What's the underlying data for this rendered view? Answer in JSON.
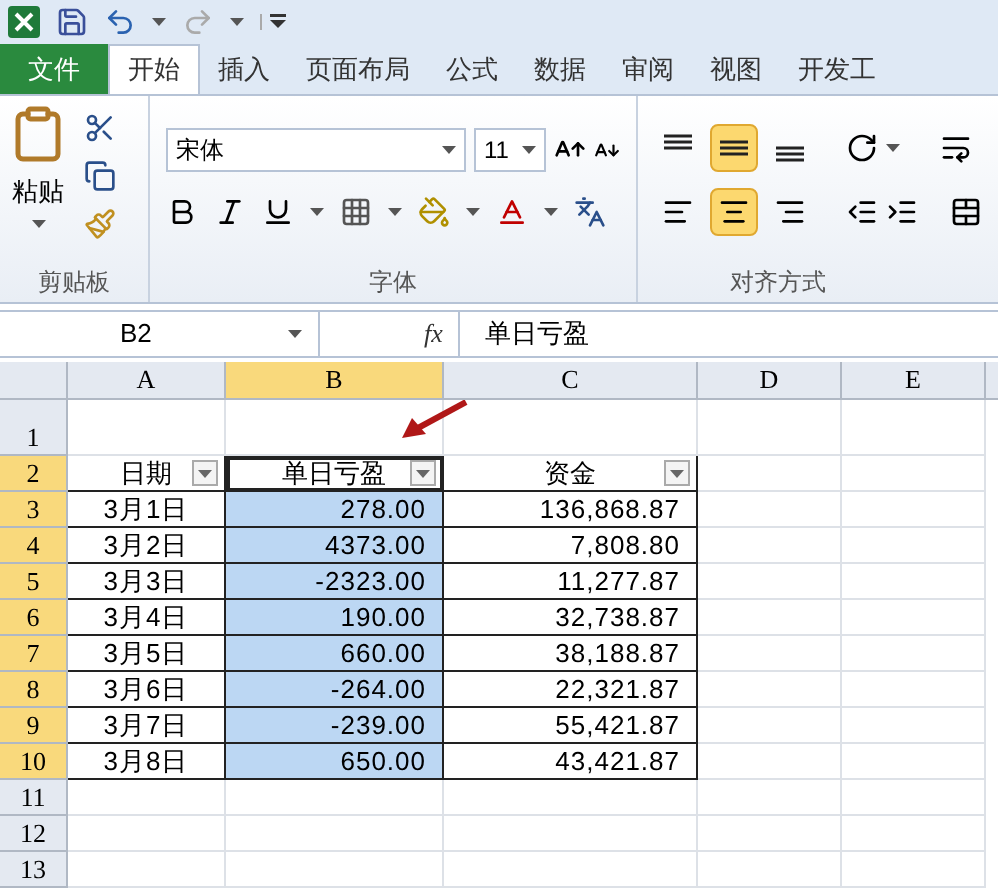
{
  "ribbon_tabs": [
    {
      "label": "文件",
      "kind": "file",
      "selected": false
    },
    {
      "label": "开始",
      "kind": "tab",
      "selected": true
    },
    {
      "label": "插入",
      "kind": "tab",
      "selected": false
    },
    {
      "label": "页面布局",
      "kind": "tab",
      "selected": false
    },
    {
      "label": "公式",
      "kind": "tab",
      "selected": false
    },
    {
      "label": "数据",
      "kind": "tab",
      "selected": false
    },
    {
      "label": "审阅",
      "kind": "tab",
      "selected": false
    },
    {
      "label": "视图",
      "kind": "tab",
      "selected": false
    },
    {
      "label": "开发工",
      "kind": "tab",
      "selected": false
    }
  ],
  "clipboard": {
    "paste_label": "粘贴",
    "group_label": "剪贴板"
  },
  "font": {
    "font_name": "宋体",
    "font_size": "11",
    "group_label": "字体"
  },
  "alignment": {
    "group_label": "对齐方式",
    "vertical": [
      {
        "kind": "top",
        "selected": false
      },
      {
        "kind": "middle",
        "selected": true
      },
      {
        "kind": "bottom",
        "selected": false
      }
    ],
    "horizontal": [
      {
        "kind": "left",
        "selected": false
      },
      {
        "kind": "center",
        "selected": true
      },
      {
        "kind": "right",
        "selected": false
      }
    ]
  },
  "formula_bar": {
    "name_box": "B2",
    "fx": "fx",
    "content": "单日亏盈"
  },
  "sheet": {
    "columns": [
      {
        "label": "A",
        "selected": false
      },
      {
        "label": "B",
        "selected": true
      },
      {
        "label": "C",
        "selected": false
      },
      {
        "label": "D",
        "selected": false
      },
      {
        "label": "E",
        "selected": false
      }
    ],
    "rows": [
      {
        "number": "1",
        "selected": false
      },
      {
        "number": "2",
        "selected": true,
        "header": [
          "日期",
          "单日亏盈",
          "资金"
        ]
      },
      {
        "number": "3",
        "selected": true,
        "cells": [
          "3月1日",
          "278.00",
          "136,868.87"
        ]
      },
      {
        "number": "4",
        "selected": true,
        "cells": [
          "3月2日",
          "4373.00",
          "7,808.80"
        ]
      },
      {
        "number": "5",
        "selected": true,
        "cells": [
          "3月3日",
          "-2323.00",
          "11,277.87"
        ]
      },
      {
        "number": "6",
        "selected": true,
        "cells": [
          "3月4日",
          "190.00",
          "32,738.87"
        ]
      },
      {
        "number": "7",
        "selected": true,
        "cells": [
          "3月5日",
          "660.00",
          "38,188.87"
        ]
      },
      {
        "number": "8",
        "selected": true,
        "cells": [
          "3月6日",
          "-264.00",
          "22,321.87"
        ]
      },
      {
        "number": "9",
        "selected": true,
        "cells": [
          "3月7日",
          "-239.00",
          "55,421.87"
        ]
      },
      {
        "number": "10",
        "selected": true,
        "cells": [
          "3月8日",
          "650.00",
          "43,421.87"
        ]
      },
      {
        "number": "11",
        "selected": false
      },
      {
        "number": "12",
        "selected": false
      },
      {
        "number": "13",
        "selected": false
      }
    ]
  }
}
